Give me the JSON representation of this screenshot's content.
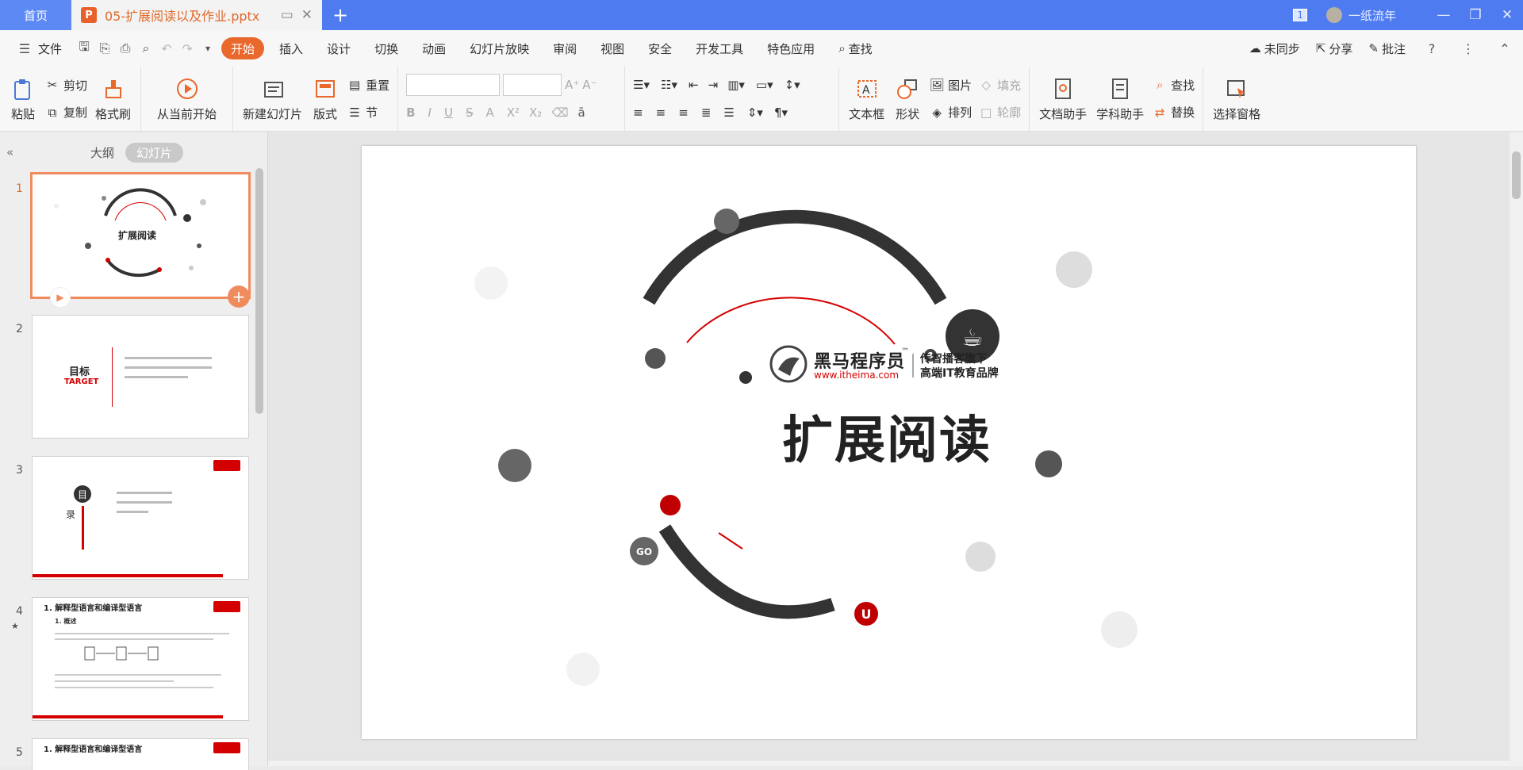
{
  "titlebar": {
    "home_label": "首页",
    "doc_name": "05-扩展阅读以及作业.pptx",
    "badge": "1",
    "user": "一纸流年"
  },
  "menubar": {
    "file": "文件",
    "tabs": [
      "开始",
      "插入",
      "设计",
      "切换",
      "动画",
      "幻灯片放映",
      "审阅",
      "视图",
      "安全",
      "开发工具",
      "特色应用"
    ],
    "search": "查找",
    "sync": "未同步",
    "share": "分享",
    "annotate": "批注"
  },
  "ribbon": {
    "paste": "粘贴",
    "cut": "剪切",
    "copy": "复制",
    "format_painter": "格式刷",
    "from_current": "从当前开始",
    "new_slide": "新建幻灯片",
    "layout": "版式",
    "reset": "重置",
    "section": "节",
    "textbox": "文本框",
    "shape": "形状",
    "picture": "图片",
    "fill": "填充",
    "arrange": "排列",
    "outline": "轮廓",
    "doc_helper": "文档助手",
    "subject_helper": "学科助手",
    "find": "查找",
    "replace": "替换",
    "select_pane": "选择窗格"
  },
  "panel": {
    "outline_tab": "大纲",
    "slides_tab": "幻灯片",
    "thumbs": [
      {
        "num": "1",
        "title": "扩展阅读"
      },
      {
        "num": "2",
        "title": "目标",
        "subtitle": "TARGET"
      },
      {
        "num": "3",
        "title": "目",
        "subtitle": "录"
      },
      {
        "num": "4",
        "title": "1. 解释型语言和编译型语言",
        "sub": "1. 概述"
      },
      {
        "num": "5",
        "title": "1. 解释型语言和编译型语言"
      }
    ]
  },
  "slide": {
    "logo_cn": "黑马程序员",
    "logo_tm": "™",
    "logo_url": "www.itheima.com",
    "slogan1": "传智播客旗下",
    "slogan2": "高端IT教育品牌",
    "title": "扩展阅读"
  }
}
